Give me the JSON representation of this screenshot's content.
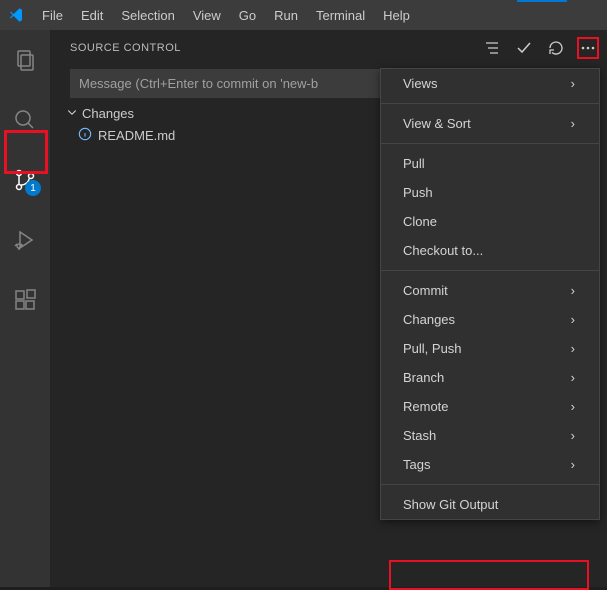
{
  "menu": {
    "file": "File",
    "edit": "Edit",
    "selection": "Selection",
    "view": "View",
    "go": "Go",
    "run": "Run",
    "terminal": "Terminal",
    "help": "Help"
  },
  "activity": {
    "scm_badge": "1"
  },
  "sidebar": {
    "title": "SOURCE CONTROL",
    "commit_placeholder": "Message (Ctrl+Enter to commit on 'new-b",
    "changes_label": "Changes",
    "file_name": "README.md"
  },
  "context_menu": {
    "views": "Views",
    "view_sort": "View & Sort",
    "pull": "Pull",
    "push": "Push",
    "clone": "Clone",
    "checkout": "Checkout to...",
    "commit": "Commit",
    "changes": "Changes",
    "pull_push": "Pull, Push",
    "branch": "Branch",
    "remote": "Remote",
    "stash": "Stash",
    "tags": "Tags",
    "show_git_output": "Show Git Output"
  }
}
